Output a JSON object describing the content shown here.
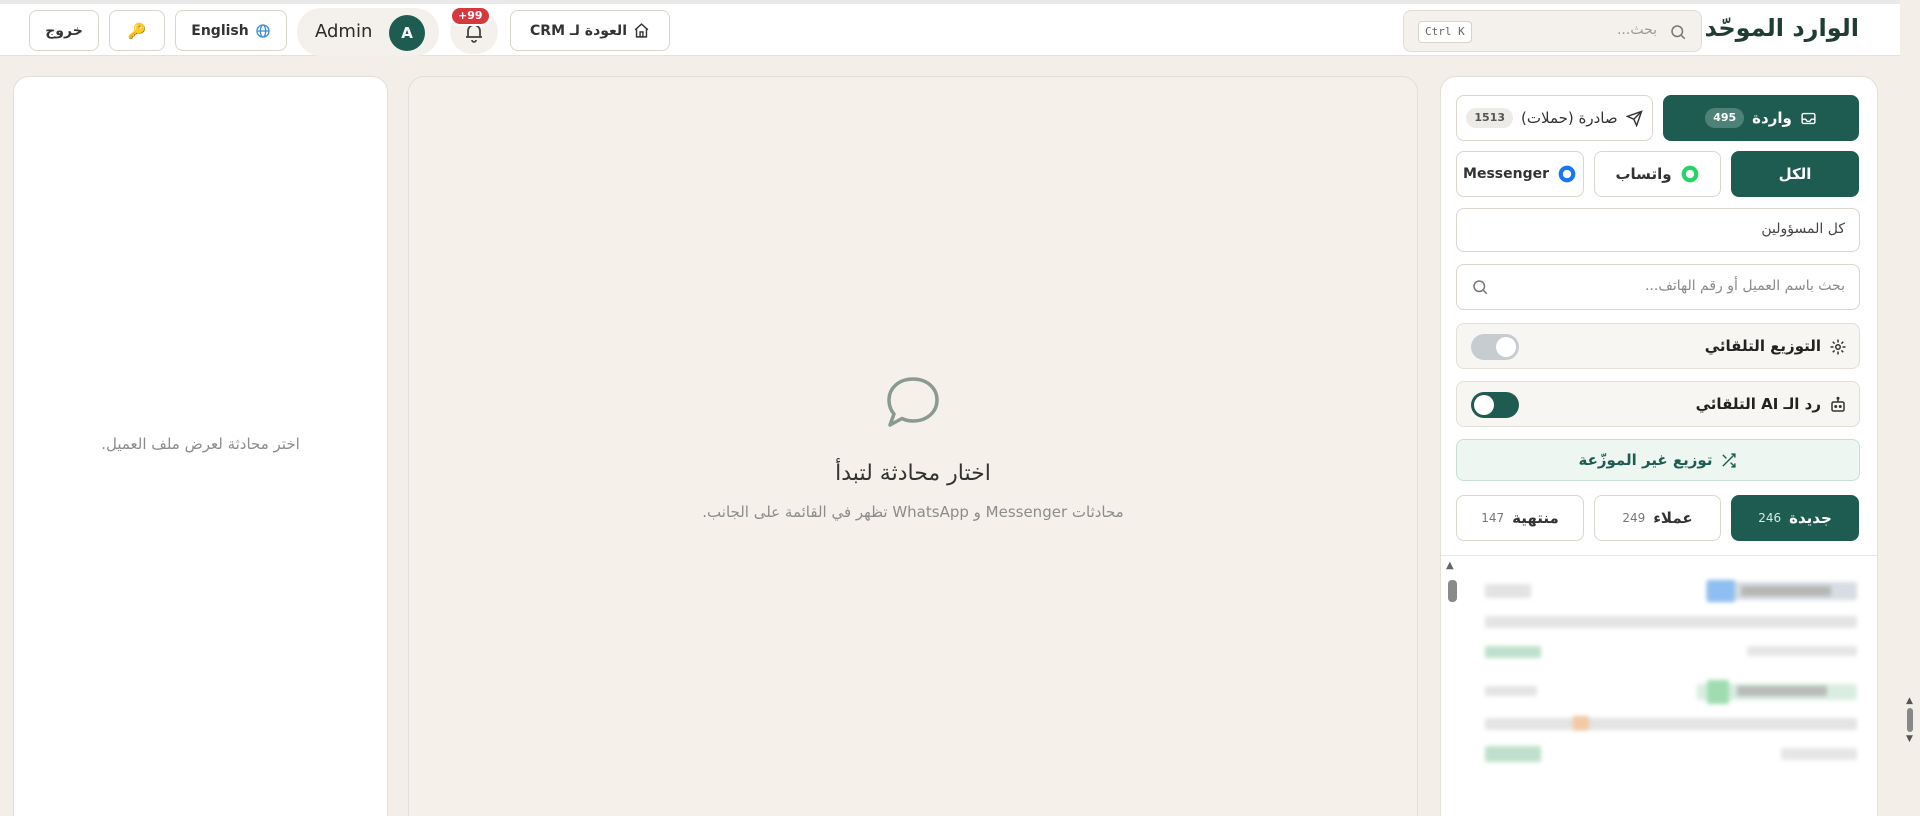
{
  "header": {
    "app_title": "الوارد الموحّد",
    "search_placeholder": "بحث...",
    "search_shortcut": "Ctrl K",
    "back_to_crm_label": "العودة لـ CRM",
    "notifications_badge": "+99",
    "user_name": "Admin",
    "user_initial": "A",
    "language_label": "English",
    "key_icon": "🔑",
    "logout_label": "خروج"
  },
  "sidebar": {
    "direction_tabs": [
      {
        "label": "واردة",
        "count": "495",
        "active": true
      },
      {
        "label": "صادرة (حملات)",
        "count": "1513",
        "active": false
      }
    ],
    "channel_tabs": [
      {
        "label": "الكل",
        "active": true
      },
      {
        "label": "واتساب",
        "active": false
      },
      {
        "label": "Messenger",
        "active": false
      }
    ],
    "assignee_select": "كل المسؤولين",
    "customer_search_placeholder": "بحث باسم العميل أو رقم الهاتف...",
    "auto_distribution": {
      "label": "التوزيع التلقائي",
      "enabled": false
    },
    "ai_auto_reply": {
      "label": "رد الـ AI التلقائي",
      "enabled": true
    },
    "distribute_unassigned_label": "توزيع غير الموزّعة",
    "status_tabs": [
      {
        "label": "جديدة",
        "count": "246",
        "active": true
      },
      {
        "label": "عملاء",
        "count": "249",
        "active": false
      },
      {
        "label": "منتهية",
        "count": "147",
        "active": false
      }
    ]
  },
  "center": {
    "empty_title": "اختار محادثة لتبدأ",
    "empty_subtitle": "محادثات Messenger و WhatsApp تظهر في القائمة على الجانب."
  },
  "profile": {
    "empty_text": "اختر محادثة لعرض ملف العميل."
  },
  "colors": {
    "accent": "#1e5c52",
    "badge_red": "#d7373f",
    "whatsapp_green": "#25d366",
    "messenger_blue": "#1877f2"
  }
}
